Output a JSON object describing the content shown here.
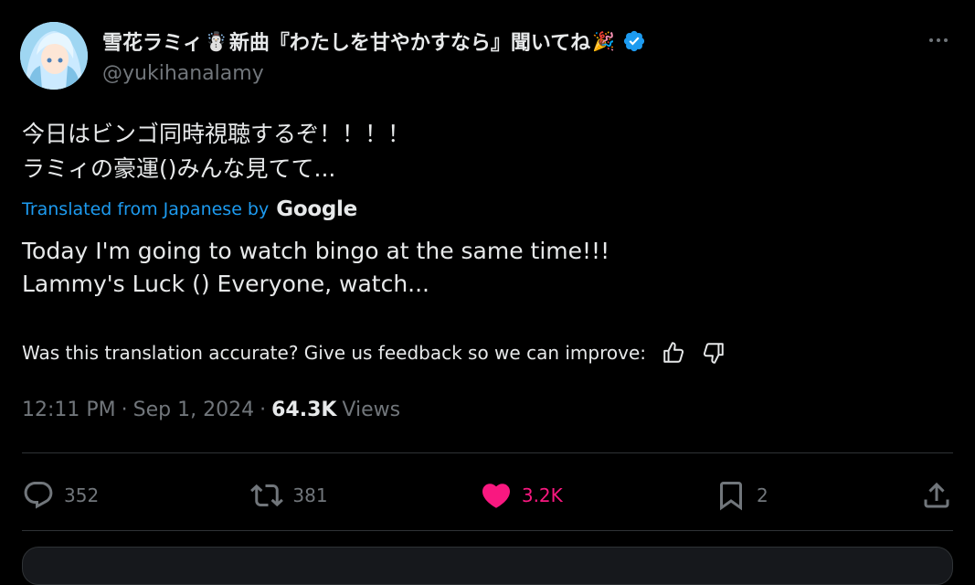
{
  "tweet": {
    "display_name": "雪花ラミィ",
    "name_emoji_1": "☃️",
    "name_suffix": "新曲『わたしを甘やかすなら』聞いてね",
    "name_emoji_2": "🎉",
    "handle": "@yukihanalamy",
    "text_line1": "今日はビンゴ同時視聴するぞ！！！！",
    "text_line2": "ラミィの豪運()みんな見てて...",
    "translated_from": "Translated from Japanese by",
    "translator": "Google",
    "translation_line1": "Today I'm going to watch bingo at the same time!!!",
    "translation_line2": "Lammy's Luck () Everyone, watch...",
    "feedback_prompt": "Was this translation accurate? Give us feedback so we can improve:",
    "time": "12:11 PM",
    "date": "Sep 1, 2024",
    "separator": "·",
    "views_count": "64.3K",
    "views_label": "Views"
  },
  "actions": {
    "replies": "352",
    "reposts": "381",
    "likes": "3.2K",
    "bookmarks": "2"
  },
  "colors": {
    "background": "#000000",
    "text": "#e7e9ea",
    "muted": "#71767b",
    "link": "#1d9bf0",
    "like": "#f91880",
    "verified": "#1d9bf0"
  }
}
